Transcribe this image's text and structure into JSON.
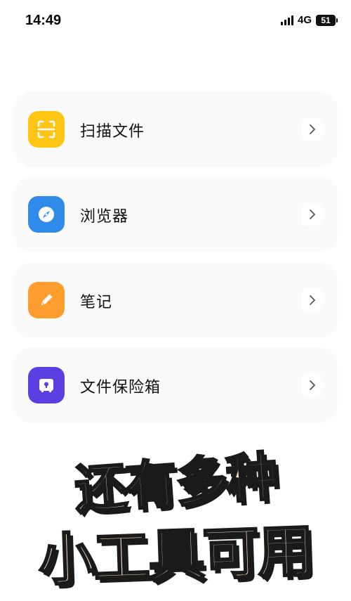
{
  "status_bar": {
    "time": "14:49",
    "network": "4G",
    "battery": "51"
  },
  "menu": {
    "items": [
      {
        "label": "扫描文件",
        "icon": "scan-icon",
        "color": "#FFC414"
      },
      {
        "label": "浏览器",
        "icon": "compass-icon",
        "color": "#2F8BEA"
      },
      {
        "label": "笔记",
        "icon": "pencil-icon",
        "color": "#FF9D2E"
      },
      {
        "label": "文件保险箱",
        "icon": "safe-icon",
        "color": "#5B3FE0"
      }
    ]
  },
  "promo": {
    "line1": "还有多种",
    "line2": "小工具可用",
    "text_color": "#F3DCC0",
    "outline_color": "#1A1A1A"
  }
}
